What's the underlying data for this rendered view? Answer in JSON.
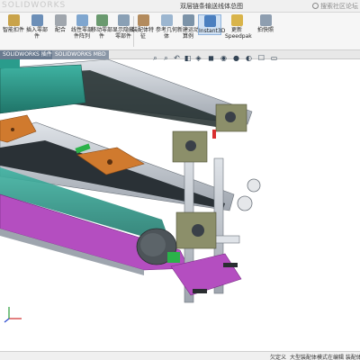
{
  "window": {
    "logo": "SOLIDWORKS",
    "title": "双层链条输送线体总图",
    "search_help": "搜索社区论坛"
  },
  "ribbon": {
    "buttons": [
      {
        "label": "智能扣件",
        "icon": "smart-fastener-icon"
      },
      {
        "label": "插入零部件",
        "icon": "insert-component-icon"
      },
      {
        "label": "配合",
        "icon": "mate-icon"
      },
      {
        "label": "线性零部件阵列",
        "icon": "linear-pattern-icon"
      },
      {
        "label": "移动零部件",
        "icon": "move-component-icon"
      },
      {
        "label": "显示隐藏零部件",
        "icon": "show-hidden-icon"
      },
      {
        "label": "装配体特征",
        "icon": "assembly-feature-icon"
      },
      {
        "label": "参考几何体",
        "icon": "reference-geometry-icon"
      },
      {
        "label": "新建运动算例",
        "icon": "motion-study-icon"
      },
      {
        "label": "材料明细表",
        "icon": "bom-icon"
      },
      {
        "label": "爆炸视图",
        "icon": "exploded-view-icon"
      },
      {
        "label": "Instant3D",
        "icon": "instant3d-icon",
        "active": true
      },
      {
        "label": "更新Speedpak",
        "icon": "speedpak-icon"
      },
      {
        "label": "拍快照",
        "icon": "snapshot-icon"
      }
    ],
    "accent": "#1f5fa8"
  },
  "tabs": [
    "SOLIDWORKS 插件",
    "SOLIDWORKS MBD"
  ],
  "hud_icons": [
    "zoom-fit-icon",
    "zoom-area-icon",
    "previous-view-icon",
    "section-view-icon",
    "view-orientation-icon",
    "display-style-icon",
    "hide-show-icon",
    "appearance-icon",
    "scene-icon",
    "view-settings-icon",
    "monitor-icon"
  ],
  "statusbar": {
    "left": "欠定义",
    "middle": "大型装配体模式",
    "right": "在编辑 装配体"
  },
  "colors": {
    "frame": "#b9bfc8",
    "belt": "#3a4048",
    "teal": "#2a9c8c",
    "magenta": "#b44ec0",
    "orange": "#d07a2e",
    "green": "#2bb24a",
    "plate": "#8c8f6a"
  }
}
